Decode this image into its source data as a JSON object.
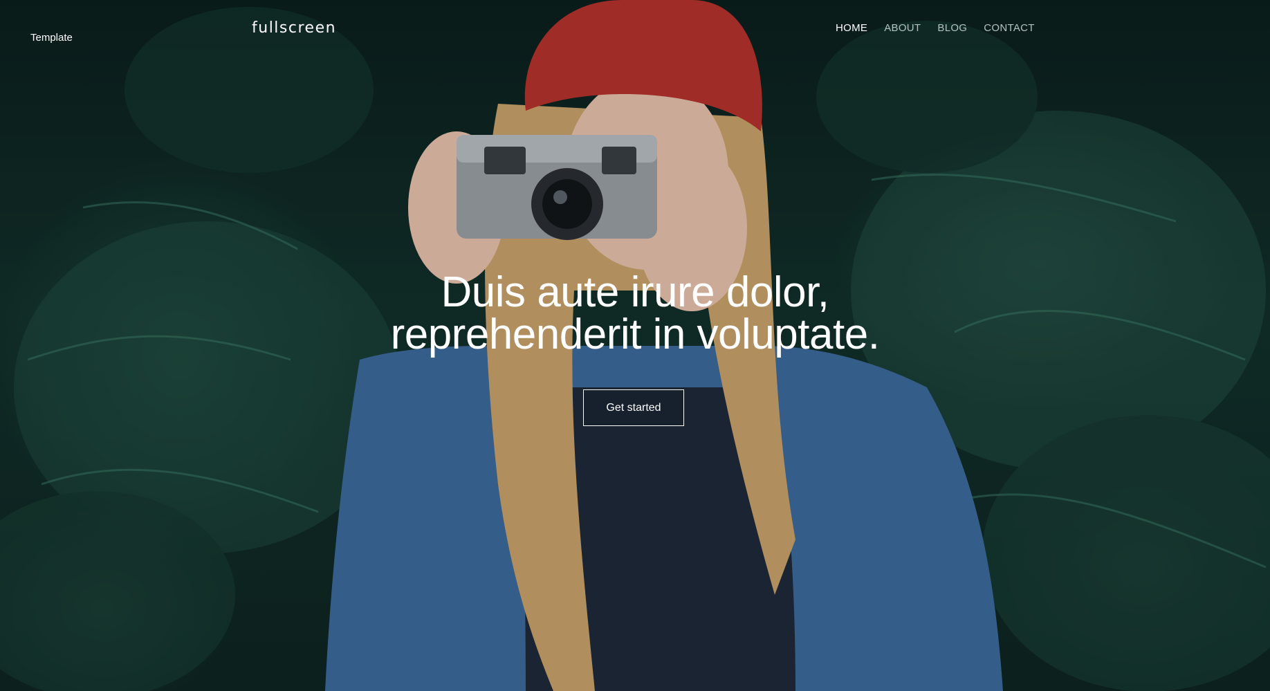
{
  "side_label": "Template",
  "brand": "fullscreen",
  "nav": {
    "items": [
      {
        "label": "HOME",
        "active": true
      },
      {
        "label": "ABOUT",
        "active": false
      },
      {
        "label": "BLOG",
        "active": false
      },
      {
        "label": "CONTACT",
        "active": false
      }
    ],
    "active_color": "#ffffff",
    "inactive_color": "#b4c2bf"
  },
  "hero": {
    "headline_line1": "Duis aute irure dolor,",
    "headline_line2": "reprehenderit in voluptate.",
    "cta_label": "Get started"
  },
  "colors": {
    "foliage_dark": "#0e2522",
    "foliage_light": "#2e6052",
    "beanie": "#b5332c",
    "denim": "#3d6a9c",
    "shirt": "#1e2a3a",
    "hair": "#c9a26a",
    "skin": "#e8c3ad",
    "camera": "#9aa0a6"
  }
}
